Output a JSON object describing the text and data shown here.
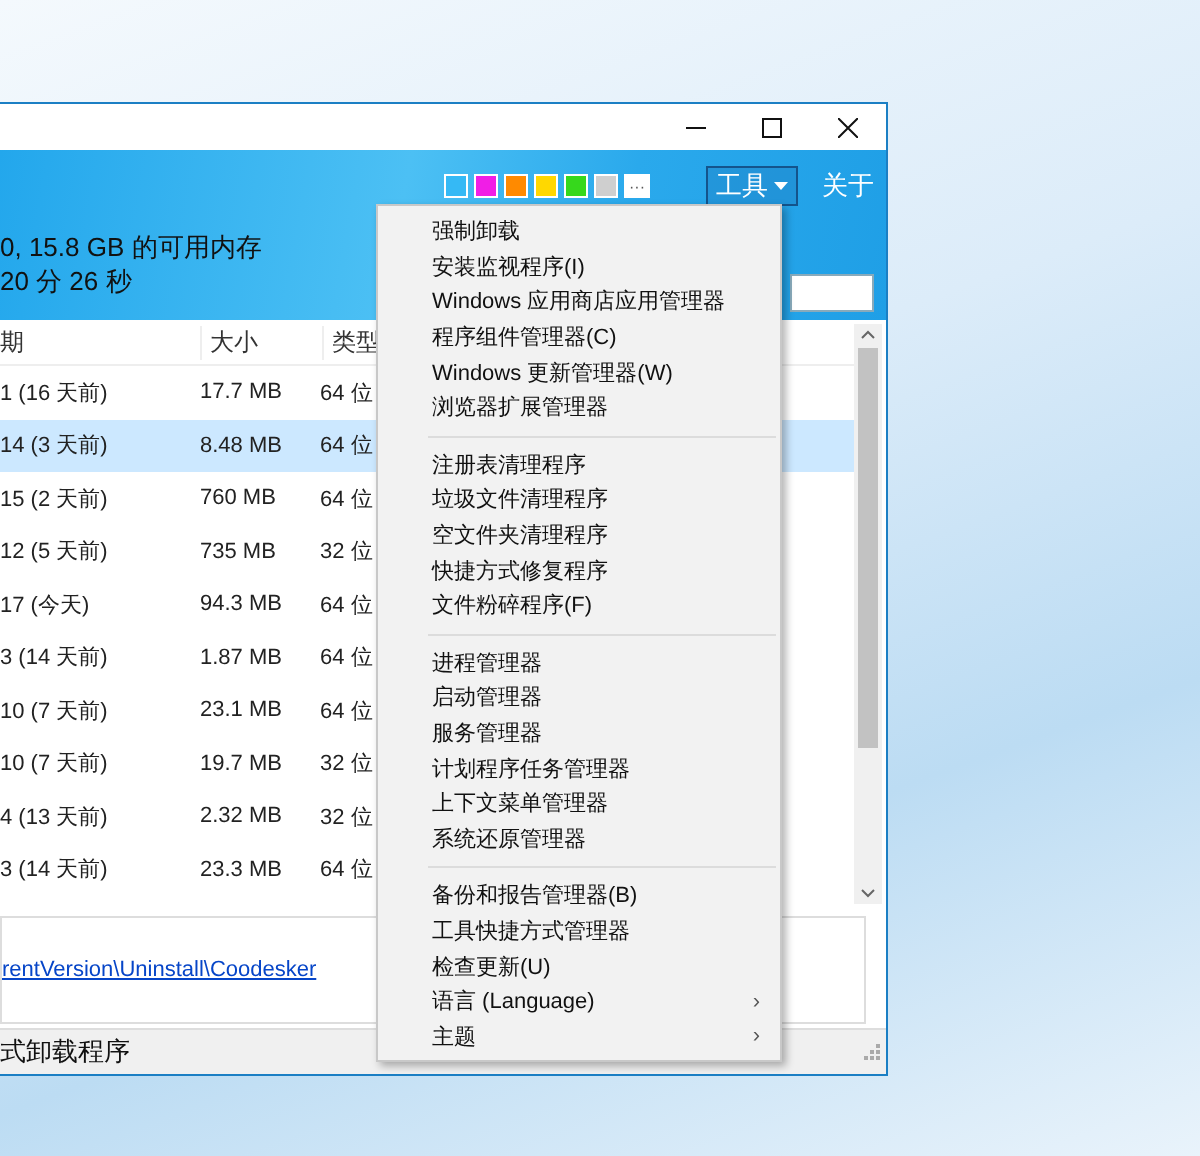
{
  "header": {
    "swatches": [
      {
        "color": "#35b9f5"
      },
      {
        "color": "#f01ee6"
      },
      {
        "color": "#ff8a00"
      },
      {
        "color": "#ffd800"
      },
      {
        "color": "#36d81c"
      },
      {
        "color": "#cfcfcf"
      }
    ],
    "more_colors": "···",
    "tools_button": "工具",
    "about": "关于",
    "info_lines": [
      "0, 15.8 GB 的可用内存",
      "20 分 26 秒"
    ]
  },
  "table": {
    "columns": [
      "期",
      "大小",
      "类型"
    ],
    "rows": [
      {
        "date": "1 (16 天前)",
        "size": "17.7 MB",
        "type": "64 位",
        "selected": false
      },
      {
        "date": "14 (3 天前)",
        "size": "8.48 MB",
        "type": "64 位",
        "selected": true
      },
      {
        "date": "15 (2 天前)",
        "size": "760 MB",
        "type": "64 位",
        "selected": false
      },
      {
        "date": "12 (5 天前)",
        "size": "735 MB",
        "type": "32 位",
        "selected": false
      },
      {
        "date": "17 (今天)",
        "size": "94.3 MB",
        "type": "64 位",
        "selected": false
      },
      {
        "date": "3 (14 天前)",
        "size": "1.87 MB",
        "type": "64 位",
        "selected": false
      },
      {
        "date": "10 (7 天前)",
        "size": "23.1 MB",
        "type": "64 位",
        "selected": false
      },
      {
        "date": "10 (7 天前)",
        "size": "19.7 MB",
        "type": "32 位",
        "selected": false
      },
      {
        "date": "4 (13 天前)",
        "size": "2.32 MB",
        "type": "32 位",
        "selected": false
      },
      {
        "date": "3 (14 天前)",
        "size": "23.3 MB",
        "type": "64 位",
        "selected": false
      }
    ]
  },
  "details": {
    "link": "rentVersion\\Uninstall\\Coodesker"
  },
  "status_bar": "式卸载程序",
  "menu": [
    {
      "kind": "item",
      "label": "强制卸载"
    },
    {
      "kind": "item",
      "label": "安装监视程序(I)"
    },
    {
      "kind": "item",
      "label": "Windows 应用商店应用管理器"
    },
    {
      "kind": "item",
      "label": "程序组件管理器(C)"
    },
    {
      "kind": "item",
      "label": "Windows 更新管理器(W)"
    },
    {
      "kind": "item",
      "label": "浏览器扩展管理器"
    },
    {
      "kind": "separator"
    },
    {
      "kind": "item",
      "label": "注册表清理程序"
    },
    {
      "kind": "item",
      "label": "垃圾文件清理程序"
    },
    {
      "kind": "item",
      "label": "空文件夹清理程序"
    },
    {
      "kind": "item",
      "label": "快捷方式修复程序"
    },
    {
      "kind": "item",
      "label": "文件粉碎程序(F)"
    },
    {
      "kind": "separator"
    },
    {
      "kind": "item",
      "label": "进程管理器"
    },
    {
      "kind": "item",
      "label": "启动管理器"
    },
    {
      "kind": "item",
      "label": "服务管理器"
    },
    {
      "kind": "item",
      "label": "计划程序任务管理器"
    },
    {
      "kind": "item",
      "label": "上下文菜单管理器"
    },
    {
      "kind": "item",
      "label": "系统还原管理器"
    },
    {
      "kind": "separator"
    },
    {
      "kind": "item",
      "label": "备份和报告管理器(B)"
    },
    {
      "kind": "item",
      "label": "工具快捷方式管理器"
    },
    {
      "kind": "item",
      "label": "检查更新(U)"
    },
    {
      "kind": "submenu",
      "label": "语言 (Language)",
      "arrow": "›"
    },
    {
      "kind": "submenu",
      "label": "主题",
      "arrow": "›"
    }
  ]
}
